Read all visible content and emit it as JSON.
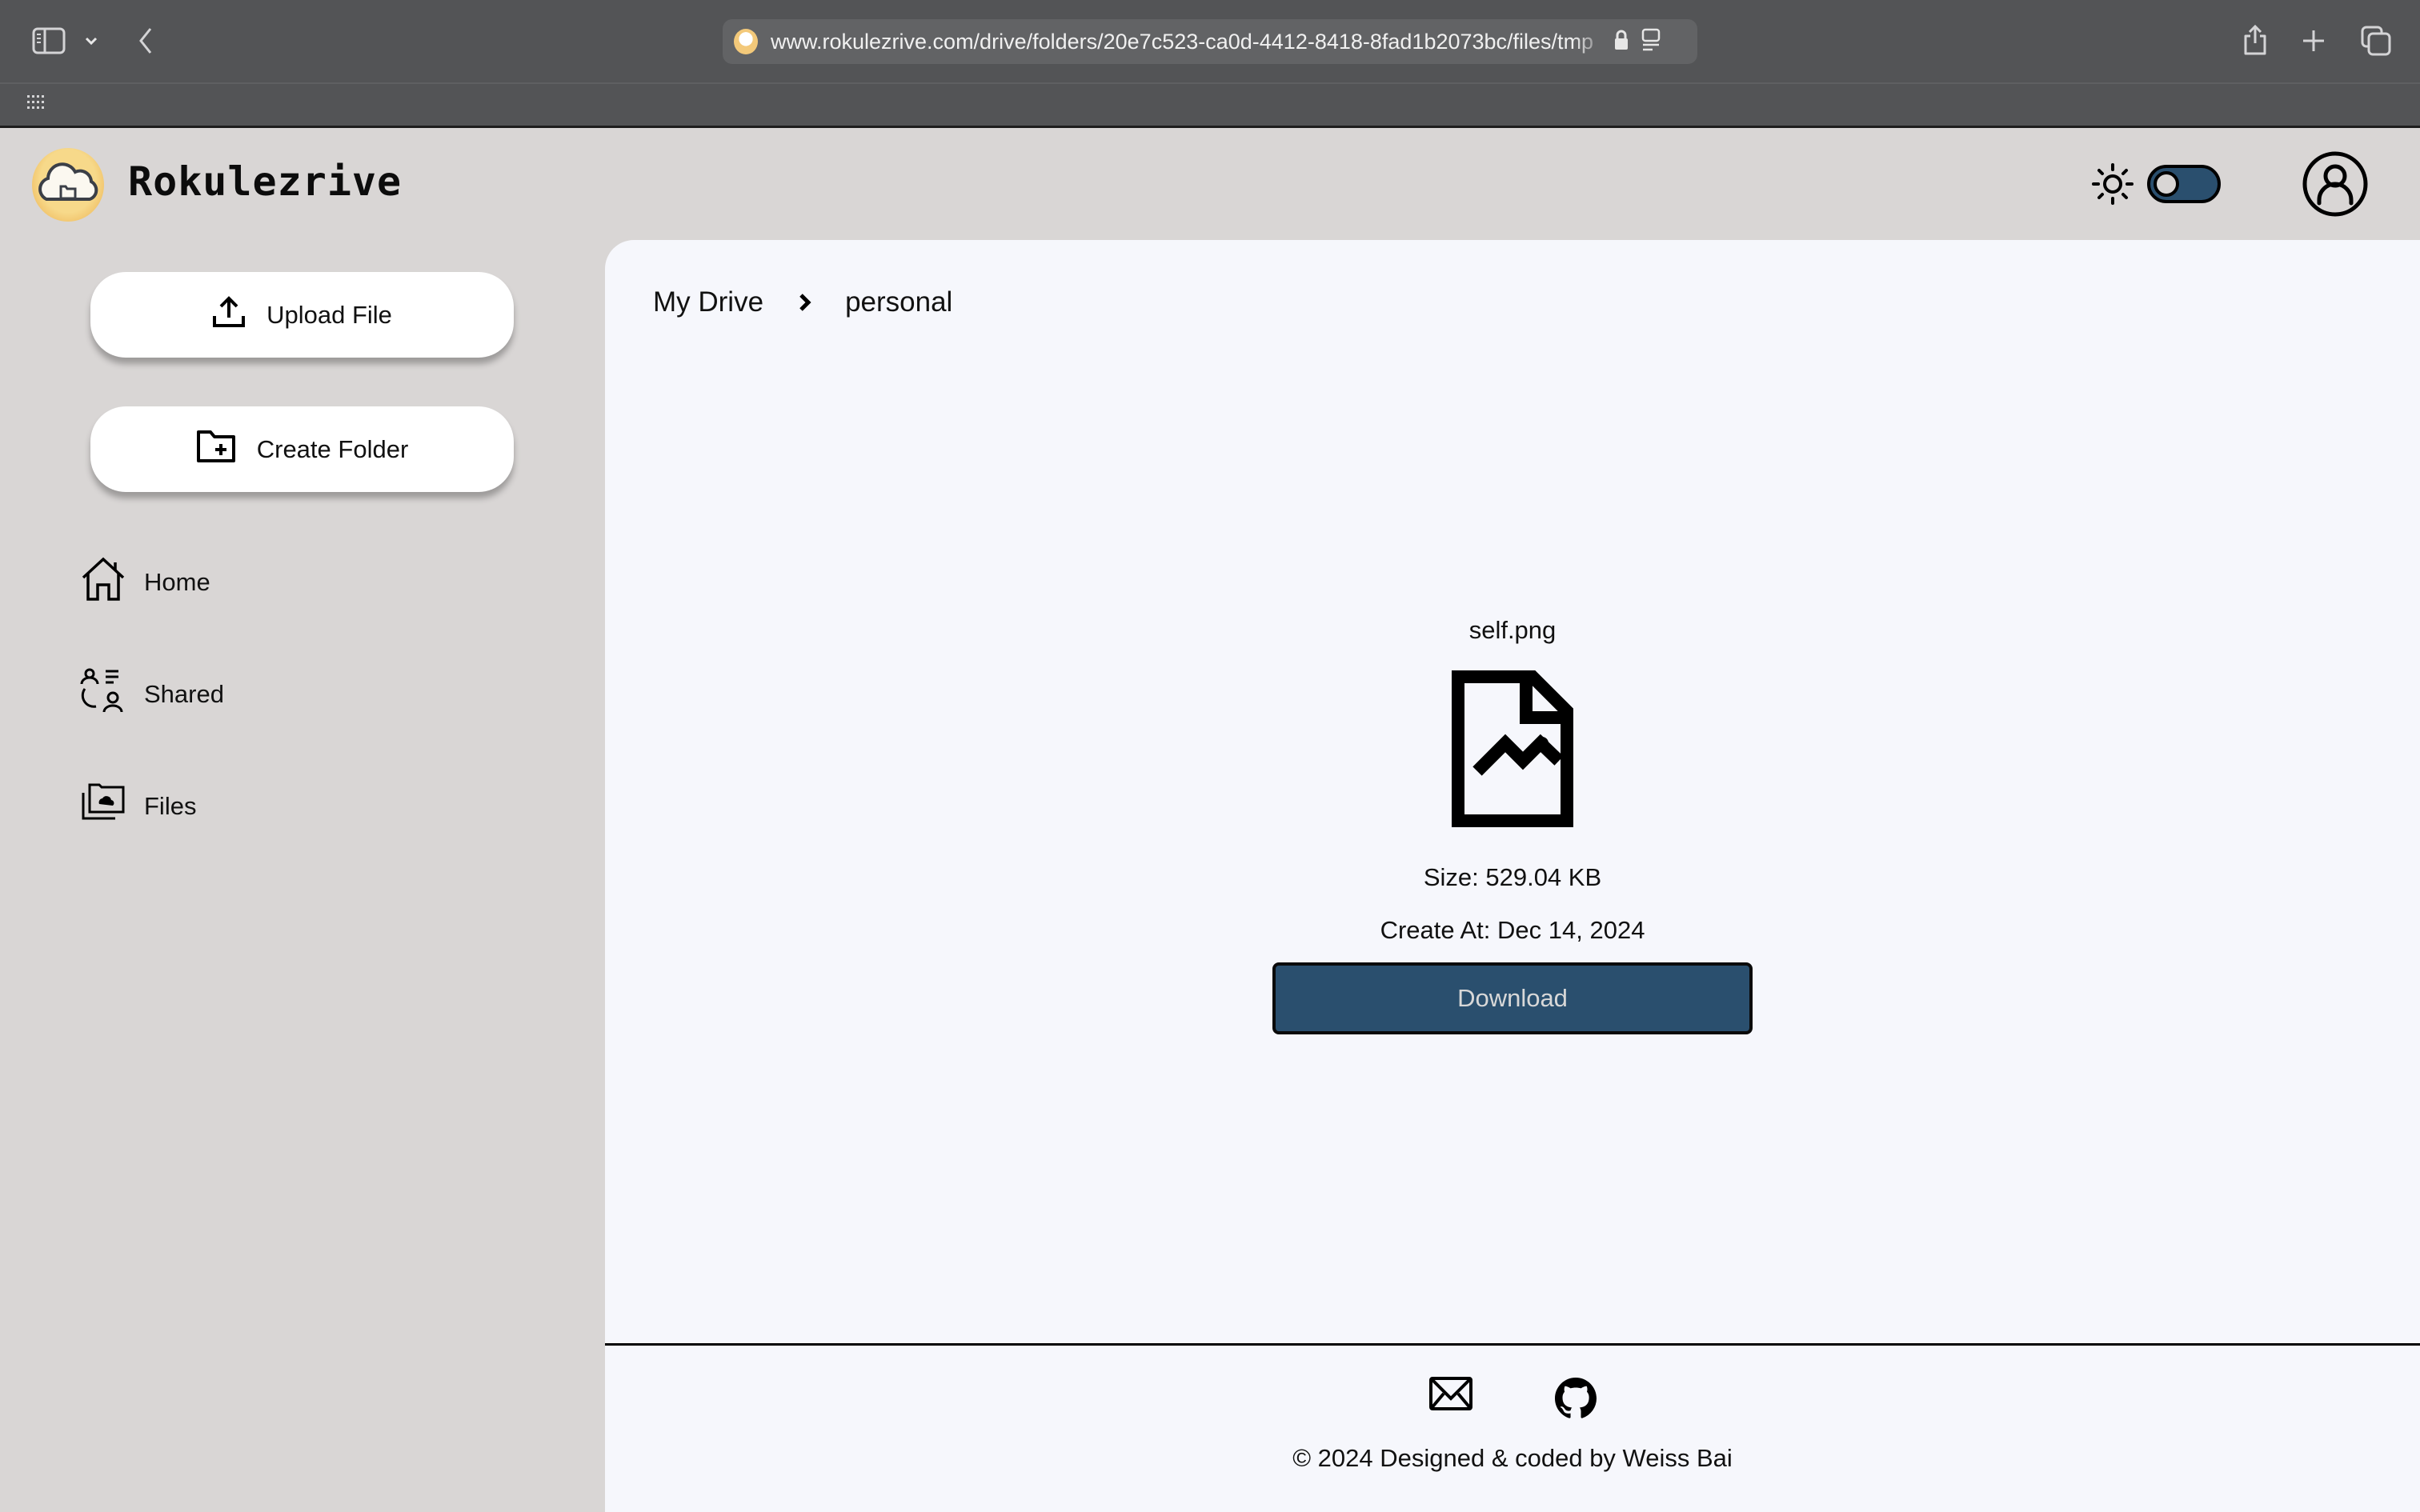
{
  "browser": {
    "url": "www.rokulezrive.com/drive/folders/20e7c523-ca0d-4412-8418-8fad1b2073bc/files/tmp",
    "icons": [
      "sidebar-toggle-icon",
      "chevron-down-icon",
      "back-icon",
      "lock-icon",
      "reader-icon",
      "share-icon",
      "new-tab-icon",
      "tabs-overview-icon",
      "apps-grid-icon"
    ]
  },
  "header": {
    "app_title": "Rokulezrive",
    "theme_mode": "light",
    "theme_toggle_on": false
  },
  "sidebar": {
    "buttons": [
      {
        "label": "Upload File",
        "icon": "upload-icon"
      },
      {
        "label": "Create Folder",
        "icon": "folder-plus-icon"
      }
    ],
    "nav": [
      {
        "label": "Home",
        "icon": "home-icon"
      },
      {
        "label": "Shared",
        "icon": "shared-users-icon"
      },
      {
        "label": "Files",
        "icon": "cloud-folder-icon"
      }
    ]
  },
  "main": {
    "breadcrumb": [
      "My Drive",
      "personal"
    ],
    "file": {
      "name": "self.png",
      "icon": "image-file-icon",
      "size_text": "Size: 529.04 KB",
      "created_text": "Create At: Dec 14, 2024",
      "download_label": "Download"
    }
  },
  "footer": {
    "icons": [
      "mail-icon",
      "github-icon"
    ],
    "copyright": "© 2024 Designed & coded by Weiss Bai"
  },
  "colors": {
    "accent": "#2a4f6e",
    "sidebar_bg": "#d9d6d5",
    "main_bg": "#f6f7fc",
    "browser_chrome": "#535456"
  }
}
